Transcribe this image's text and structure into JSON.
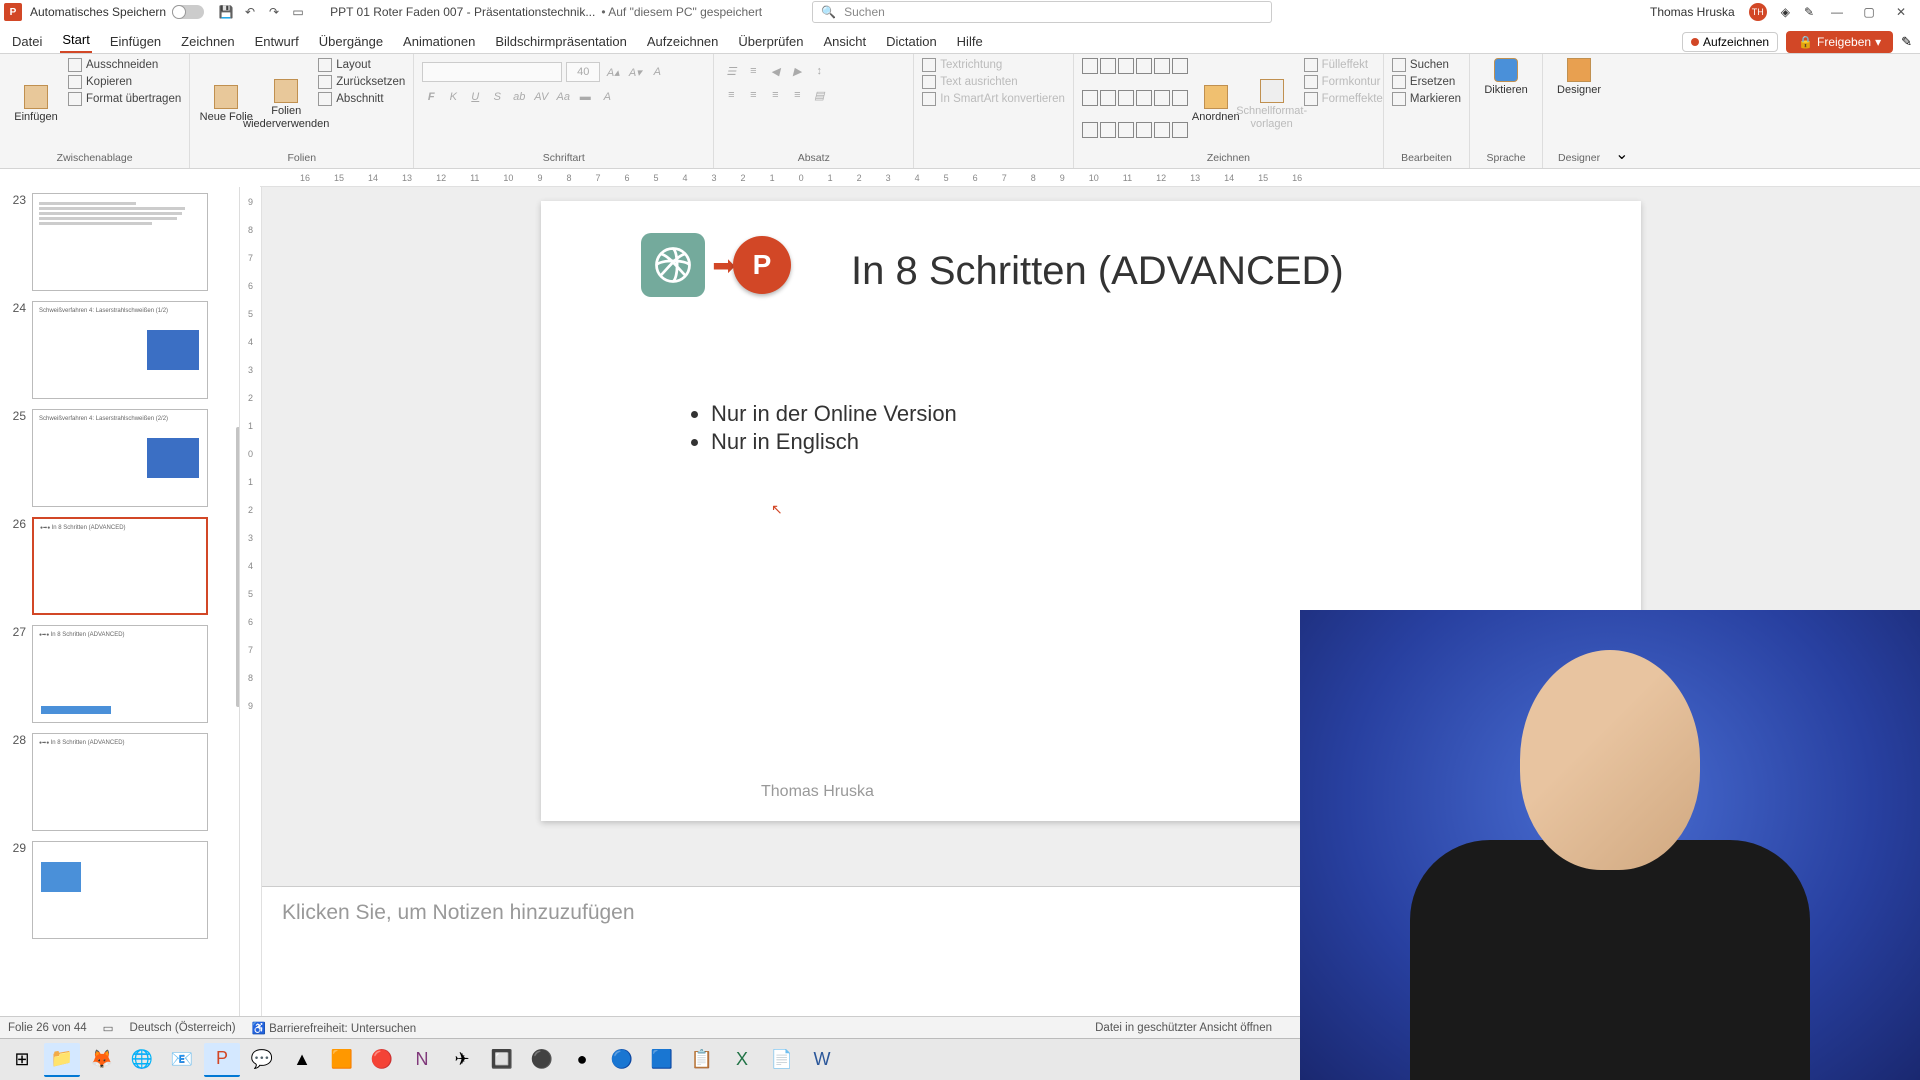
{
  "titlebar": {
    "autosave_label": "Automatisches Speichern",
    "doc_title": "PPT 01 Roter Faden 007 - Präsentationstechnik...",
    "doc_saved": "• Auf \"diesem PC\" gespeichert",
    "search_placeholder": "Suchen",
    "user_name": "Thomas Hruska",
    "user_initials": "TH"
  },
  "tabs": {
    "datei": "Datei",
    "start": "Start",
    "einfuegen": "Einfügen",
    "zeichnen": "Zeichnen",
    "entwurf": "Entwurf",
    "uebergaenge": "Übergänge",
    "animationen": "Animationen",
    "bildschirm": "Bildschirmpräsentation",
    "aufzeichnen": "Aufzeichnen",
    "ueberpruefen": "Überprüfen",
    "ansicht": "Ansicht",
    "dictation": "Dictation",
    "hilfe": "Hilfe",
    "record_btn": "Aufzeichnen",
    "share_btn": "Freigeben"
  },
  "ribbon": {
    "einfuegen": "Einfügen",
    "ausschneiden": "Ausschneiden",
    "kopieren": "Kopieren",
    "format_uebertragen": "Format übertragen",
    "zwischenablage": "Zwischenablage",
    "neue_folie": "Neue Folie",
    "folien_wieder": "Folien wiederverwenden",
    "layout": "Layout",
    "zuruecksetzen": "Zurücksetzen",
    "abschnitt": "Abschnitt",
    "folien": "Folien",
    "schriftart": "Schriftart",
    "absatz": "Absatz",
    "textrichtung": "Textrichtung",
    "text_ausrichten": "Text ausrichten",
    "smartart": "In SmartArt konvertieren",
    "anordnen": "Anordnen",
    "schnellformat": "Schnellformat-vorlagen",
    "fuelleffekt": "Fülleffekt",
    "formkontur": "Formkontur",
    "formeffekte": "Formeffekte",
    "zeichnen": "Zeichnen",
    "suchen": "Suchen",
    "ersetzen": "Ersetzen",
    "markieren": "Markieren",
    "bearbeiten": "Bearbeiten",
    "diktieren": "Diktieren",
    "sprache": "Sprache",
    "designer": "Designer",
    "designer_grp": "Designer",
    "font_size": "40"
  },
  "ruler": [
    "16",
    "15",
    "14",
    "13",
    "12",
    "11",
    "10",
    "9",
    "8",
    "7",
    "6",
    "5",
    "4",
    "3",
    "2",
    "1",
    "0",
    "1",
    "2",
    "3",
    "4",
    "5",
    "6",
    "7",
    "8",
    "9",
    "10",
    "11",
    "12",
    "13",
    "14",
    "15",
    "16"
  ],
  "vruler": [
    "9",
    "8",
    "7",
    "6",
    "5",
    "4",
    "3",
    "2",
    "1",
    "0",
    "1",
    "2",
    "3",
    "4",
    "5",
    "6",
    "7",
    "8",
    "9"
  ],
  "thumbs": {
    "n23": "23",
    "n24": "24",
    "n25": "25",
    "n26": "26",
    "n27": "27",
    "n28": "28",
    "n29": "29",
    "t24": "Schweißverfahren 4: Laserstrahlschweißen (1/2)",
    "t25": "Schweißverfahren 4: Laserstrahlschweißen (2/2)",
    "t26": "In 8 Schritten  (ADVANCED)",
    "t27": "In 8 Schritten  (ADVANCED)",
    "t28": "In 8 Schritten  (ADVANCED)"
  },
  "slide": {
    "title": "In 8 Schritten  (ADVANCED)",
    "bullet1": "Nur in der Online Version",
    "bullet2": "Nur in Englisch",
    "footer": "Thomas Hruska",
    "ppt_p": "P"
  },
  "notes": {
    "placeholder": "Klicken Sie, um Notizen hinzuzufügen"
  },
  "status": {
    "slide_count": "Folie 26 von 44",
    "lang": "Deutsch (Österreich)",
    "access": "Barrierefreiheit: Untersuchen",
    "protected": "Datei in geschützter Ansicht öffnen"
  }
}
